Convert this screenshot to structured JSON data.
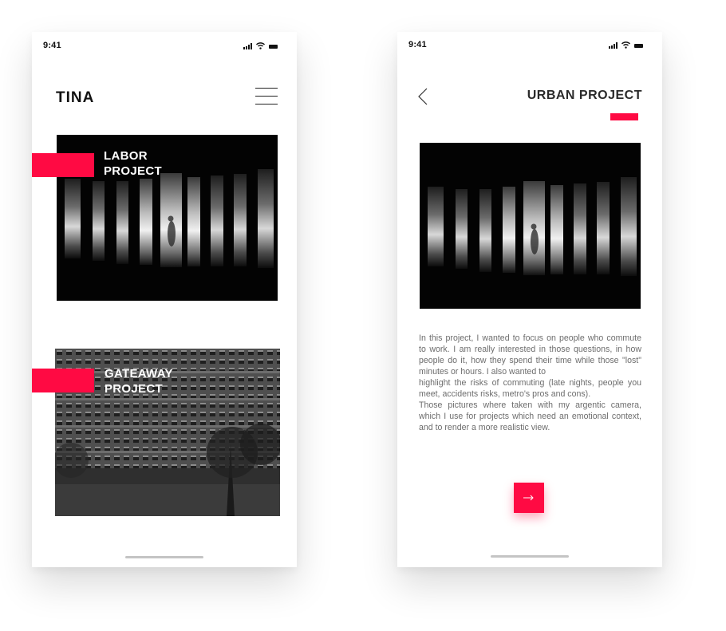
{
  "status_bar": {
    "time": "9:41"
  },
  "home_screen": {
    "brand": "TINA",
    "projects": [
      {
        "title": "LABOR\nPROJECT",
        "image": "dark-light-slats-photo"
      },
      {
        "title": "GATEAWAY\nPROJECT",
        "image": "apartment-block-photo"
      }
    ]
  },
  "detail_screen": {
    "title": "URBAN PROJECT",
    "image": "dark-light-slats-photo",
    "paragraphs": [
      "In this project, I wanted to focus on people who commute to work. I am really interested in those questions, in how people do it, how they spend their time while those \"lost\" minutes or hours. I also wanted to",
      "highlight the risks of commuting (late nights, people you meet, accidents risks, metro's pros and cons).",
      "Those pictures where taken with my argentic camera, which I use for projects which need an emotional context, and to render a more realistic view."
    ]
  },
  "colors": {
    "accent": "#ff0a43",
    "text_dark": "#111111",
    "text_body": "#6d6d6d"
  },
  "icons": [
    "menu-icon",
    "back-arrow-icon",
    "arrow-right-icon",
    "signal-icon",
    "wifi-icon",
    "battery-icon"
  ]
}
